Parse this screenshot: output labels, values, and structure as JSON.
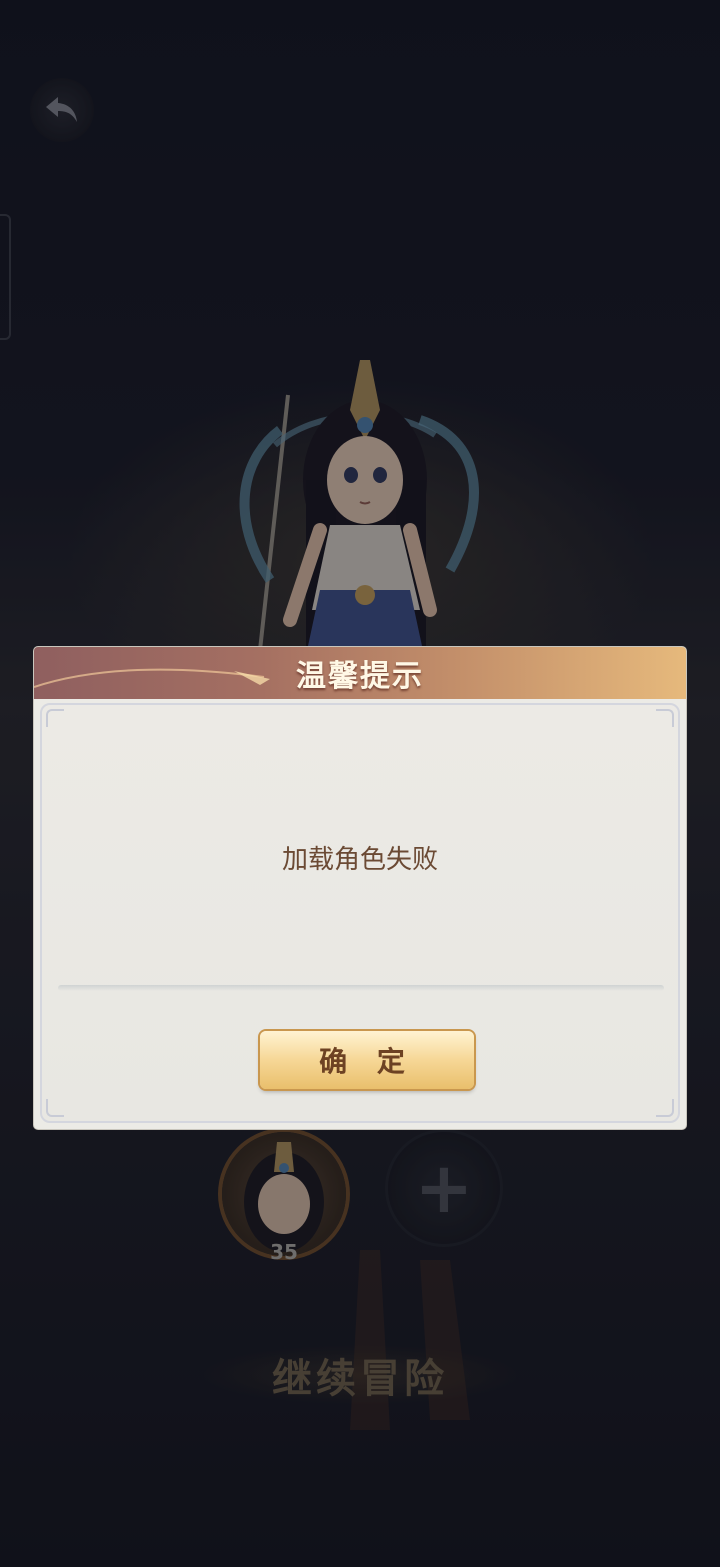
{
  "dialog": {
    "title": "温馨提示",
    "message": "加载角色失败",
    "confirm_label": "确 定"
  },
  "party": {
    "hero_level": "35",
    "add_label": "+"
  },
  "continue_label": "继续冒险",
  "icons": {
    "back": "back-arrow-icon",
    "add": "plus-icon"
  },
  "colors": {
    "title_text": "#fff8e6",
    "message_text": "#6b4a34",
    "button_gold": "#f6d796"
  }
}
